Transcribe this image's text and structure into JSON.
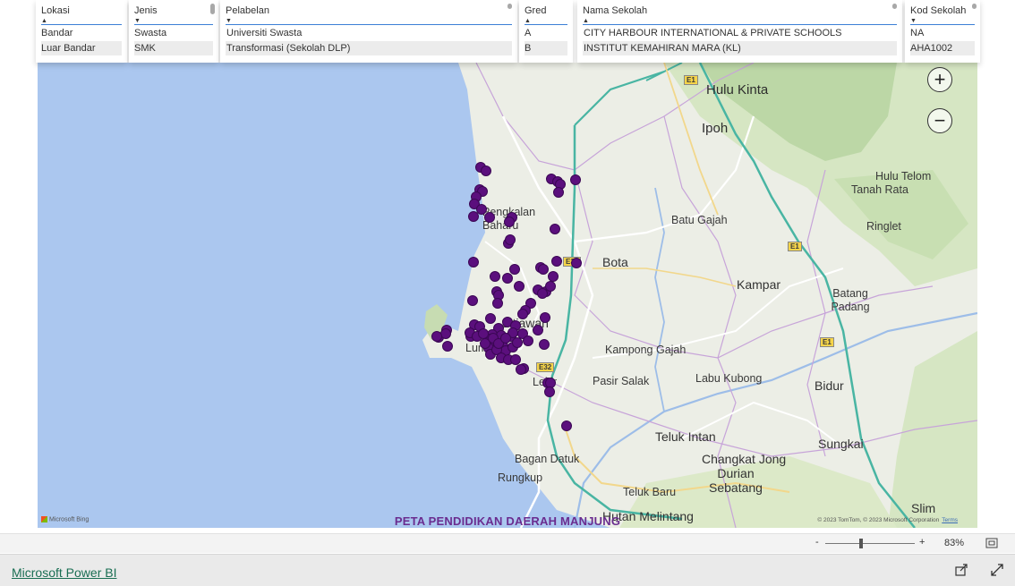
{
  "slicers": {
    "lokasi": {
      "title": "Lokasi",
      "items": [
        "Bandar",
        "Luar Bandar"
      ]
    },
    "jenis": {
      "title": "Jenis",
      "items": [
        "Swasta",
        "SMK"
      ]
    },
    "pelabelan": {
      "title": "Pelabelan",
      "items": [
        "Universiti Swasta",
        "Transformasi (Sekolah DLP)"
      ]
    },
    "gred": {
      "title": "Gred",
      "items": [
        "A",
        "B"
      ]
    },
    "nama_sekolah": {
      "title": "Nama Sekolah",
      "items": [
        "CITY HARBOUR INTERNATIONAL & PRIVATE SCHOOLS",
        "INSTITUT KEMAHIRAN MARA (KL)"
      ]
    },
    "kod_sekolah": {
      "title": "Kod Sekolah",
      "items": [
        "NA",
        "AHA1002"
      ]
    }
  },
  "map": {
    "title": "PETA PENDIDIKAN DAERAH MANJUNG",
    "bing_label": "Microsoft Bing",
    "copyright": "© 2023 TomTom, © 2023 Microsoft Corporation",
    "terms": "Terms",
    "marker_color": "#5b0f7d",
    "places": {
      "hulu_kinta": "Hulu Kinta",
      "ipoh": "Ipoh",
      "hulu_telom": "Hulu Telom",
      "tanah_rata": "Tanah Rata",
      "pengkalan_baharu": "Pengkalan Baharu",
      "batu_gajah": "Batu Gajah",
      "ringlet": "Ringlet",
      "bota": "Bota",
      "kampar": "Kampar",
      "batang_padang": "Batang Padang",
      "sitiawan": "Sitiawan",
      "lumut": "Lumut",
      "kampong_gajah": "Kampong Gajah",
      "pasir_salak": "Pasir Salak",
      "labu_kubong": "Labu Kubong",
      "bidur": "Bidur",
      "lekir": "Lekir",
      "teluk_intan": "Teluk Intan",
      "sungkai": "Sungkai",
      "bagan_datuk": "Bagan Datuk",
      "changkat_jong": "Changkat Jong",
      "rungkup": "Rungkup",
      "durian_sebatang": "Durian Sebatang",
      "teluk_baru": "Teluk Baru",
      "hutan_melintang": "Hutan Melintang",
      "slim": "Slim"
    },
    "road_labels": {
      "e1_a": "E1",
      "e1_b": "E1",
      "e1_c": "E1",
      "e32_a": "E32",
      "e32_b": "E32"
    }
  },
  "zoom_bar": {
    "minus": "-",
    "plus": "+",
    "level": "83%"
  },
  "footer": {
    "power_bi_link": "Microsoft Power BI"
  }
}
